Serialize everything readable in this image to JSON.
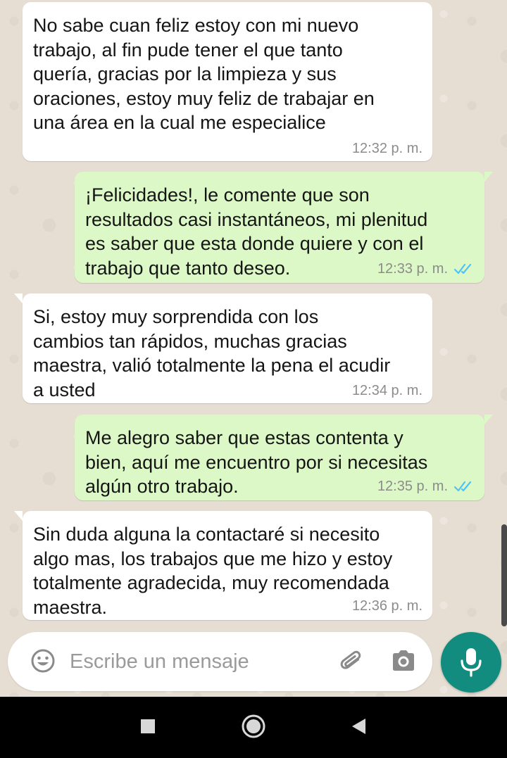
{
  "messages": [
    {
      "direction": "incoming",
      "text": "No sabe cuan feliz estoy con mi nuevo\ntrabajo, al fin pude tener el que tanto\nquería, gracias por la limpieza y sus\noraciones, estoy muy feliz de trabajar en\nuna área en la cual me especialice",
      "time": "12:32 p. m."
    },
    {
      "direction": "outgoing",
      "text": "¡Felicidades!, le comente que son\nresultados casi instantáneos, mi plenitud\nes saber que esta donde quiere y con el\ntrabajo que tanto deseo.",
      "time": "12:33 p. m.",
      "status": "read"
    },
    {
      "direction": "incoming",
      "text": "Si, estoy muy sorprendida con los\ncambios tan rápidos, muchas gracias\nmaestra, valió totalmente la pena el acudir\na usted",
      "time": "12:34 p. m."
    },
    {
      "direction": "outgoing",
      "text": "Me alegro saber que estas contenta y\nbien, aquí me encuentro por si necesitas\nalgún otro trabajo.",
      "time": "12:35 p. m.",
      "status": "read"
    },
    {
      "direction": "incoming",
      "text": "Sin duda alguna la contactaré si necesito\nalgo mas, los trabajos que me hizo y estoy\ntotalmente agradecida, muy recomendada\nmaestra.",
      "time": "12:36 p. m."
    }
  ],
  "composer": {
    "placeholder": "Escribe un mensaje",
    "value": "",
    "emoji_icon": "emoji-icon",
    "attach_icon": "paperclip-icon",
    "camera_icon": "camera-icon",
    "mic_icon": "microphone-icon"
  },
  "navigation": {
    "icons": [
      "recents-square-icon",
      "home-circle-icon",
      "back-triangle-icon"
    ]
  },
  "colors": {
    "incoming_bubble": "#ffffff",
    "outgoing_bubble": "#dcf8c6",
    "read_ticks": "#4fc3f7",
    "mic_button": "#128c7e",
    "nav_bar": "#000000"
  }
}
